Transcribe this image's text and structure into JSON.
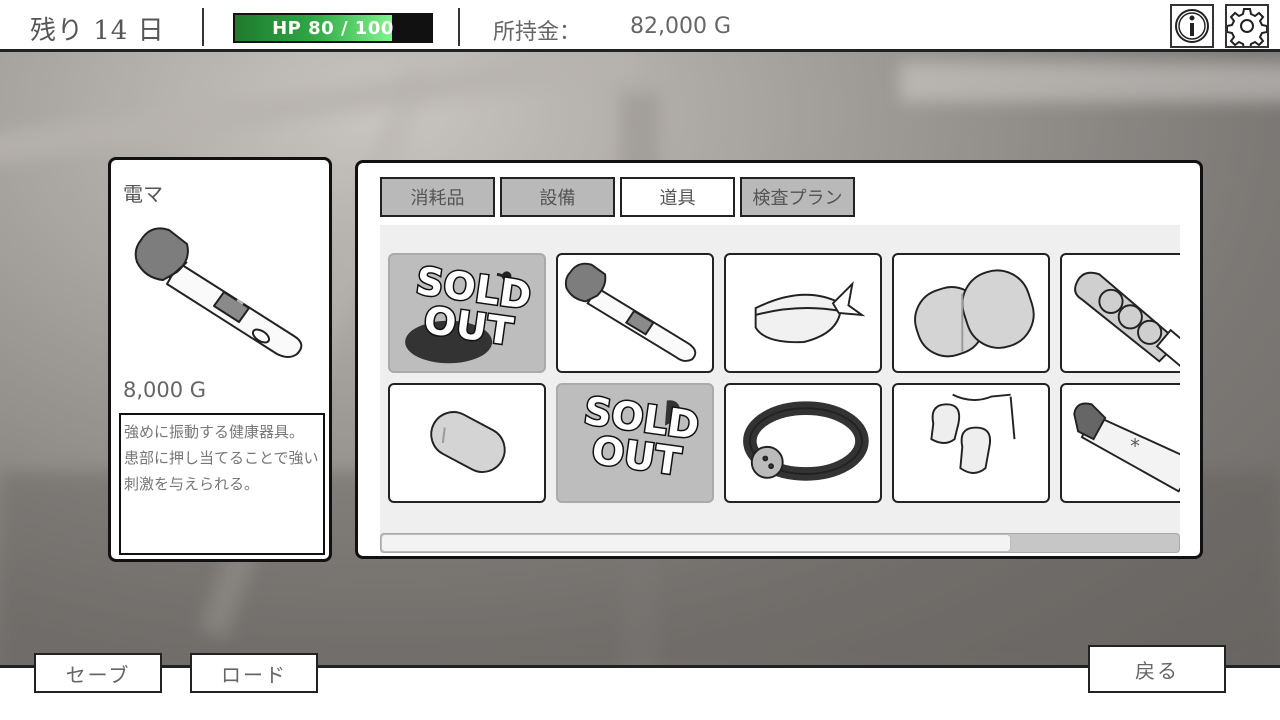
{
  "header": {
    "days_left": "残り 14 日",
    "hp_text": "HP  80 / 100",
    "hp_fraction": 0.8,
    "money_label": "所持金：",
    "money_value": "82,000 G",
    "icons": [
      "info-icon",
      "gear-icon"
    ]
  },
  "detail": {
    "name": "電マ",
    "price": "8,000 G",
    "description": "強めに振動する健康器具。\n患部に押し当てることで強い刺激を与えられる。"
  },
  "tabs": [
    {
      "label": "消耗品",
      "active": false
    },
    {
      "label": "設備",
      "active": false
    },
    {
      "label": "道具",
      "active": true
    },
    {
      "label": "検査プラン",
      "active": false
    }
  ],
  "items": {
    "sold_label_line1": "SOLD",
    "sold_label_line2": "OUT",
    "grid": [
      {
        "icon": "rotor-icon",
        "sold": true
      },
      {
        "icon": "wand-massager-icon",
        "sold": false
      },
      {
        "icon": "blindfold-icon",
        "sold": false
      },
      {
        "icon": "double-egg-icon",
        "sold": false
      },
      {
        "icon": "ribbed-toy-icon",
        "sold": false
      },
      {
        "icon": "egg-vibrator-icon",
        "sold": false
      },
      {
        "icon": "item-icon",
        "sold": true
      },
      {
        "icon": "ball-gag-icon",
        "sold": false
      },
      {
        "icon": "suction-cups-icon",
        "sold": false
      },
      {
        "icon": "tube-icon",
        "sold": false
      }
    ]
  },
  "scroll_fraction": 0.79,
  "footer": {
    "save_label": "セーブ",
    "load_label": "ロード",
    "back_label": "戻る"
  }
}
